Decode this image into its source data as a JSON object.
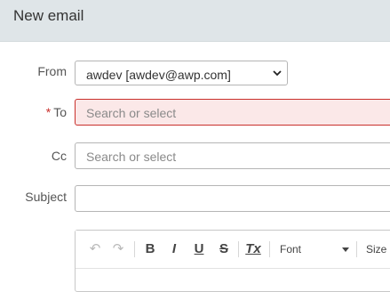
{
  "header": {
    "title": "New email"
  },
  "from": {
    "label": "From",
    "value": "awdev [awdev@awp.com]"
  },
  "to": {
    "required_mark": "*",
    "label": "To",
    "placeholder": "Search or select"
  },
  "cc": {
    "label": "Cc",
    "placeholder": "Search or select"
  },
  "subject": {
    "label": "Subject",
    "value": ""
  },
  "toolbar": {
    "undo_icon": "↶",
    "redo_icon": "↷",
    "bold": "B",
    "italic": "I",
    "underline": "U",
    "strike": "S",
    "clear_format": "Tx",
    "font_label": "Font",
    "size_label": "Size"
  },
  "colors": {
    "header_bg": "#dfe5e8",
    "error_border": "#c9302c",
    "error_bg": "#fbe8e8"
  }
}
